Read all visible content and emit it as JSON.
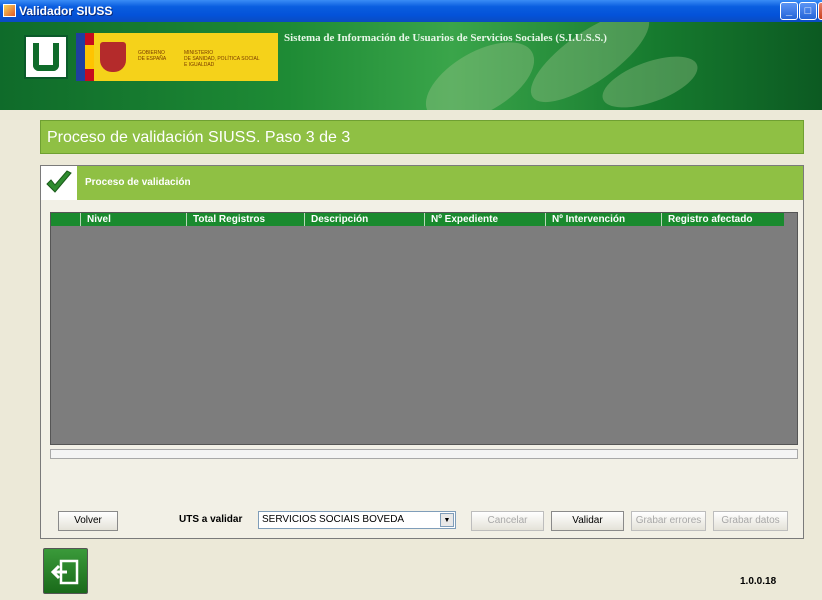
{
  "window": {
    "title": "Validador SIUSS"
  },
  "banner": {
    "title": "Sistema de Información de Usuarios de Servicios Sociales (S.I.U.S.S.)",
    "gov_line1": "GOBIERNO\nDE ESPAÑA",
    "gov_line2": "MINISTERIO\nDE SANIDAD, POLÍTICA SOCIAL\nE IGUALDAD"
  },
  "step": {
    "title": "Proceso de validación SIUSS.  Paso 3 de 3"
  },
  "section": {
    "title": "Proceso de validación"
  },
  "grid": {
    "columns": [
      "Nivel",
      "Total Registros",
      "Descripción",
      "Nº Expediente",
      "Nº Intervención",
      "Registro afectado"
    ]
  },
  "controls": {
    "back": "Volver",
    "uts_label": "UTS a validar",
    "uts_value": "SERVICIOS SOCIAIS BOVEDA",
    "cancel": "Cancelar",
    "validate": "Validar",
    "save_errors": "Grabar errores",
    "save_data": "Grabar datos"
  },
  "footer": {
    "version": "1.0.0.18"
  },
  "icons": {
    "app": "app-icon",
    "check": "check-icon",
    "exit": "exit-icon"
  },
  "colors": {
    "accent_green": "#8fc044",
    "header_green": "#1a8a2e",
    "titlebar_blue": "#0452d8"
  }
}
